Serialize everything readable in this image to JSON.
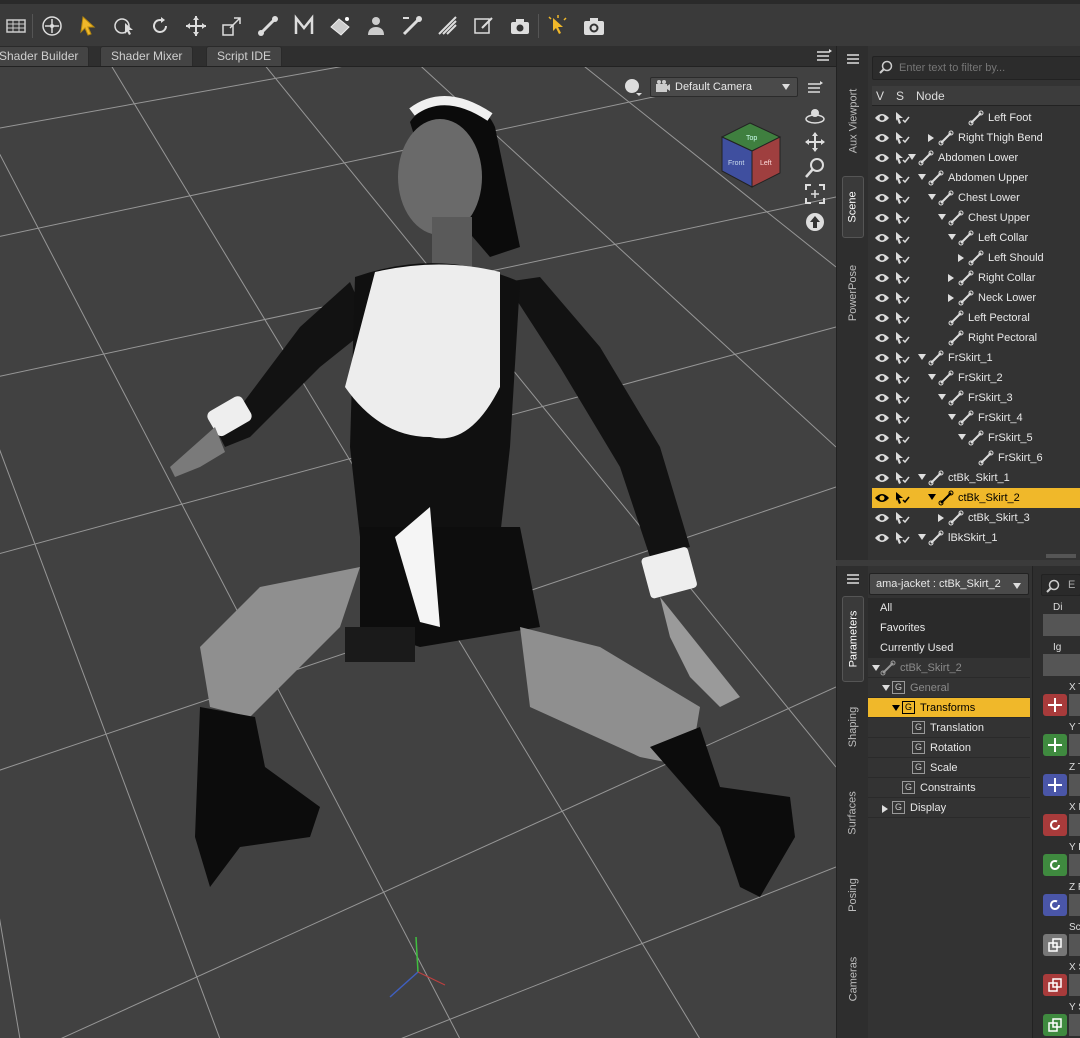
{
  "tabs": [
    {
      "label": "Shader Builder"
    },
    {
      "label": "Shader Mixer"
    },
    {
      "label": "Script IDE"
    }
  ],
  "viewport": {
    "camera": "Default Camera",
    "cube_faces": [
      "Top",
      "Front",
      "Left"
    ]
  },
  "side_tabs_top": [
    "Aux Viewport",
    "Scene",
    "PowerPose"
  ],
  "side_tabs_bottom": [
    "Parameters",
    "Shaping",
    "Surfaces",
    "Posing",
    "Cameras"
  ],
  "scene": {
    "filter_placeholder": "Enter text to filter by...",
    "columns": [
      "V",
      "S",
      "Node"
    ],
    "nodes": [
      {
        "label": "Left Foot"
      },
      {
        "label": "Right Thigh Bend"
      },
      {
        "label": "Abdomen Lower"
      },
      {
        "label": "Abdomen Upper"
      },
      {
        "label": "Chest Lower"
      },
      {
        "label": "Chest Upper"
      },
      {
        "label": "Left Collar"
      },
      {
        "label": "Left Should"
      },
      {
        "label": "Right Collar"
      },
      {
        "label": "Neck Lower"
      },
      {
        "label": "Left Pectoral"
      },
      {
        "label": "Right Pectoral"
      },
      {
        "label": "FrSkirt_1"
      },
      {
        "label": "FrSkirt_2"
      },
      {
        "label": "FrSkirt_3"
      },
      {
        "label": "FrSkirt_4"
      },
      {
        "label": "FrSkirt_5"
      },
      {
        "label": "FrSkirt_6"
      },
      {
        "label": "ctBk_Skirt_1"
      },
      {
        "label": "ctBk_Skirt_2"
      },
      {
        "label": "ctBk_Skirt_3"
      },
      {
        "label": "lBkSkirt_1"
      }
    ]
  },
  "parameters": {
    "node_selector": "ama-jacket : ctBk_Skirt_2",
    "filter_placeholder": "E",
    "groups": [
      {
        "label": "All"
      },
      {
        "label": "Favorites"
      },
      {
        "label": "Currently Used"
      },
      {
        "label": "ctBk_Skirt_2"
      },
      {
        "label": "General"
      },
      {
        "label": "Transforms"
      },
      {
        "label": "Translation"
      },
      {
        "label": "Rotation"
      },
      {
        "label": "Scale"
      },
      {
        "label": "Constraints"
      },
      {
        "label": "Display"
      }
    ],
    "strip": [
      {
        "label": "Di"
      },
      {
        "label": "Ig"
      },
      {
        "label": "X T"
      },
      {
        "label": "Y T"
      },
      {
        "label": "Z T"
      },
      {
        "label": "X R"
      },
      {
        "label": "Y R"
      },
      {
        "label": "Z R"
      },
      {
        "label": "Sc"
      },
      {
        "label": "X S"
      },
      {
        "label": "Y S"
      }
    ]
  },
  "colors": {
    "selection": "#f0b82a",
    "translate_x": "#a83b3b",
    "translate_y": "#3f8a3f",
    "translate_z": "#4a56a8"
  }
}
